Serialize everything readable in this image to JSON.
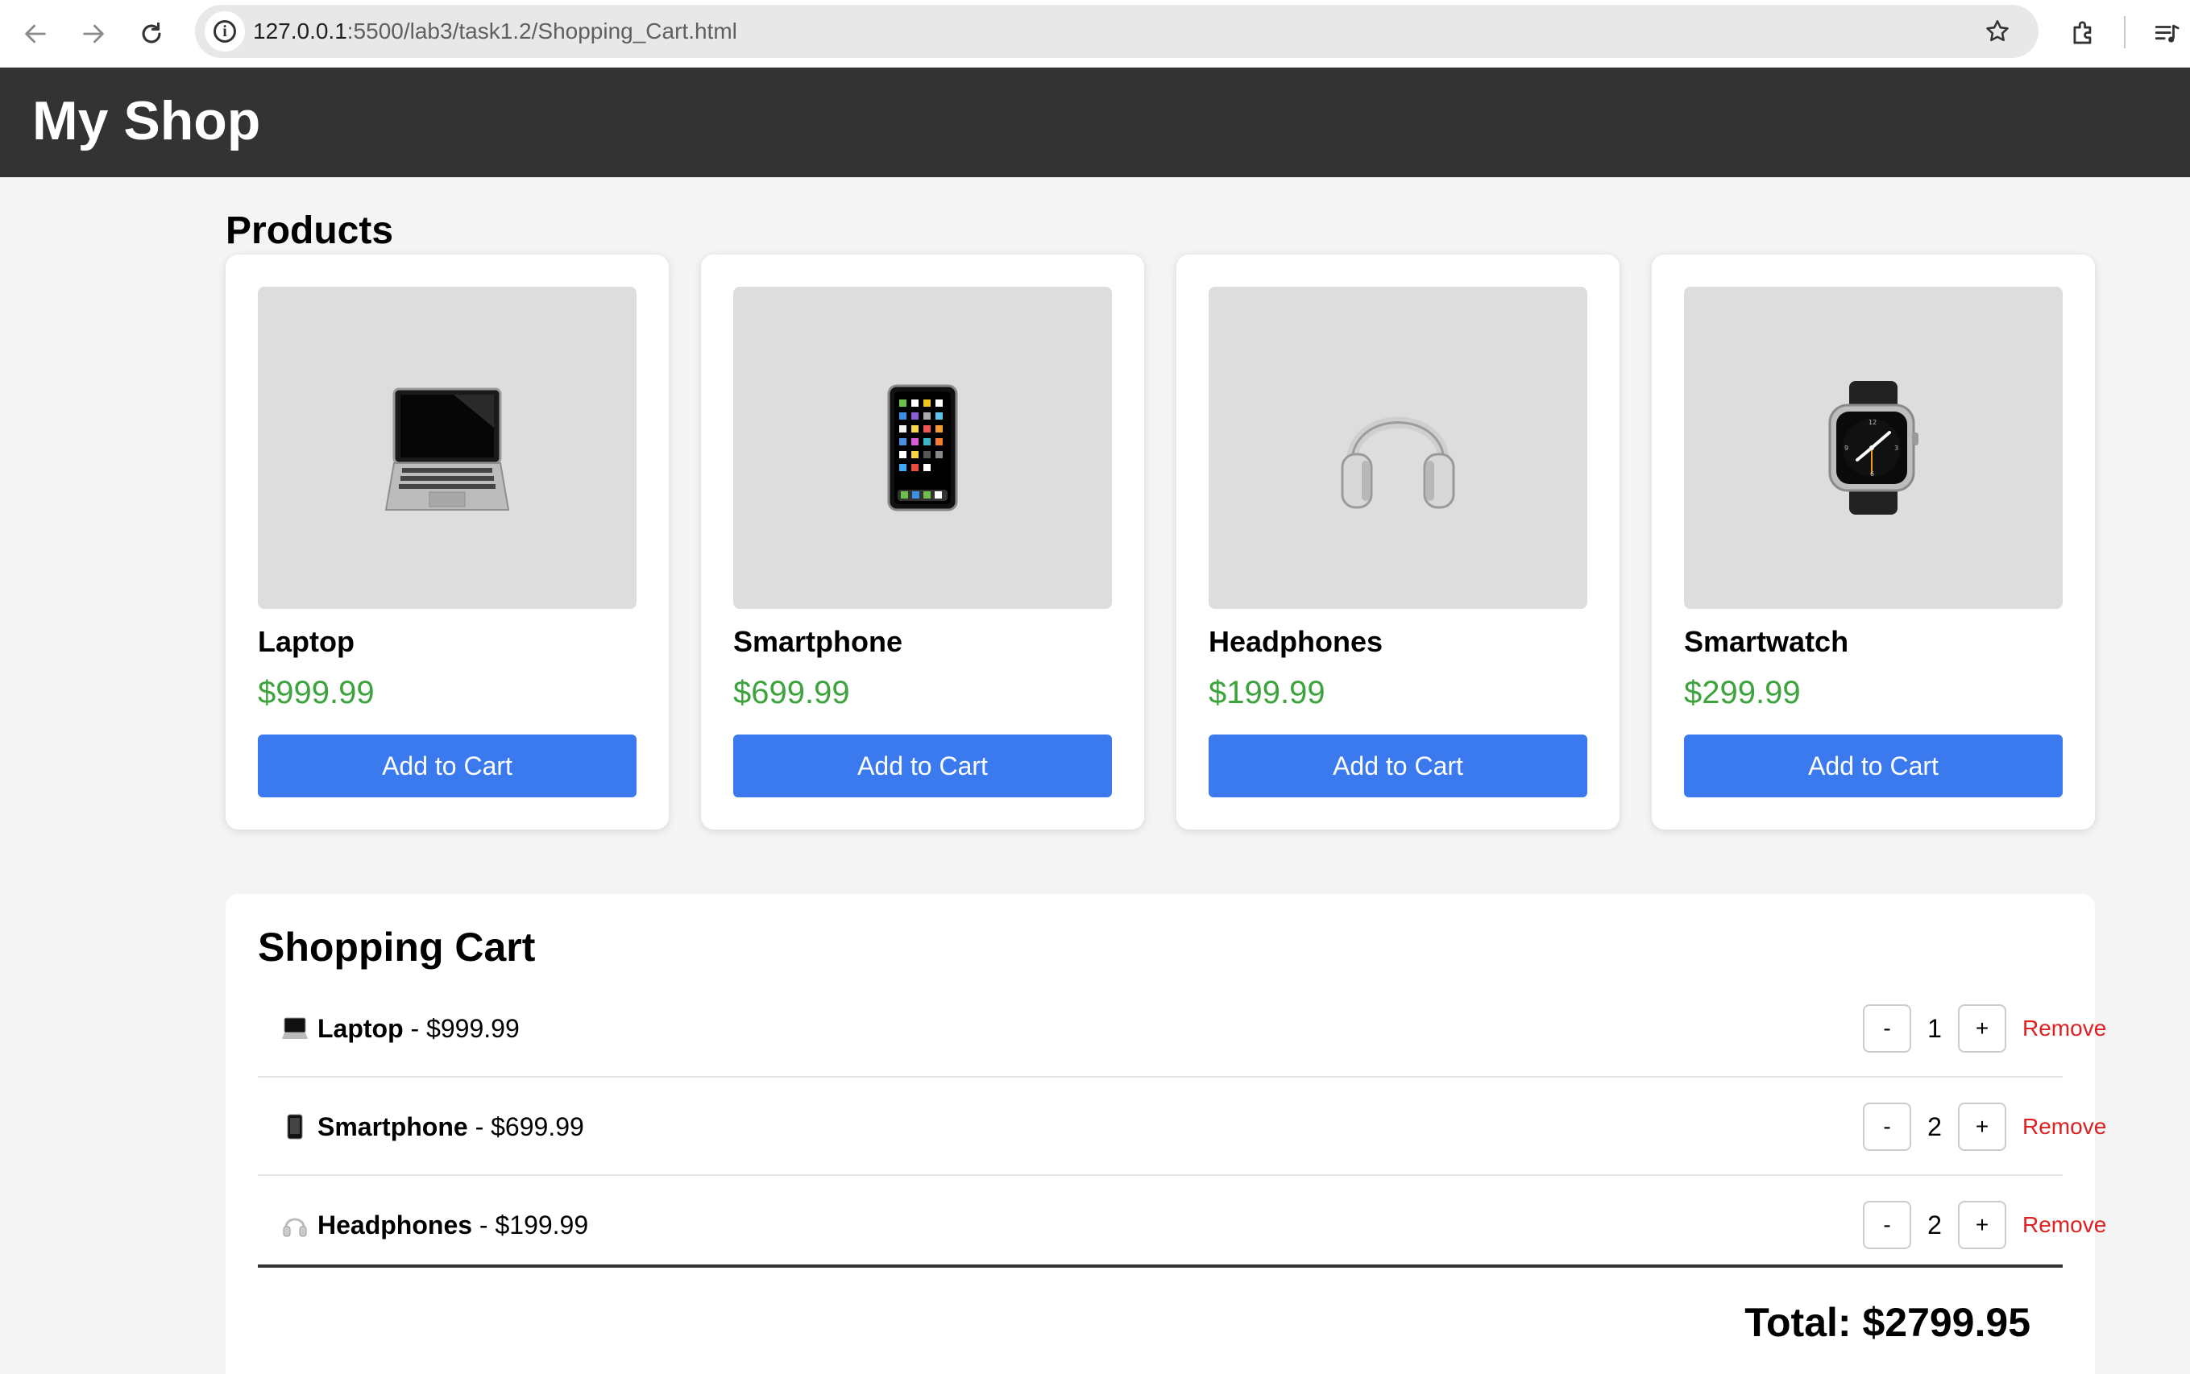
{
  "browser": {
    "url_host": "127.0.0.1",
    "url_path": ":5500/lab3/task1.2/Shopping_Cart.html"
  },
  "header": {
    "title": "My Shop"
  },
  "products": {
    "title": "Products",
    "items": [
      {
        "name": "Laptop",
        "price": "$999.99",
        "button": "Add to Cart",
        "icon": "laptop-icon"
      },
      {
        "name": "Smartphone",
        "price": "$699.99",
        "button": "Add to Cart",
        "icon": "smartphone-icon"
      },
      {
        "name": "Headphones",
        "price": "$199.99",
        "button": "Add to Cart",
        "icon": "headphones-icon"
      },
      {
        "name": "Smartwatch",
        "price": "$299.99",
        "button": "Add to Cart",
        "icon": "smartwatch-icon"
      }
    ]
  },
  "cart": {
    "title": "Shopping Cart",
    "items": [
      {
        "name": "Laptop",
        "price": " - $999.99",
        "qty": "1",
        "minus": "-",
        "plus": "+",
        "remove": "Remove"
      },
      {
        "name": "Smartphone",
        "price": " - $699.99",
        "qty": "2",
        "minus": "-",
        "plus": "+",
        "remove": "Remove"
      },
      {
        "name": "Headphones",
        "price": " - $199.99",
        "qty": "2",
        "minus": "-",
        "plus": "+",
        "remove": "Remove"
      }
    ],
    "total": "Total: $2799.95"
  },
  "colors": {
    "header_bg": "#333333",
    "accent": "#3a7aee",
    "price": "#3da33d",
    "remove": "#e02020"
  }
}
